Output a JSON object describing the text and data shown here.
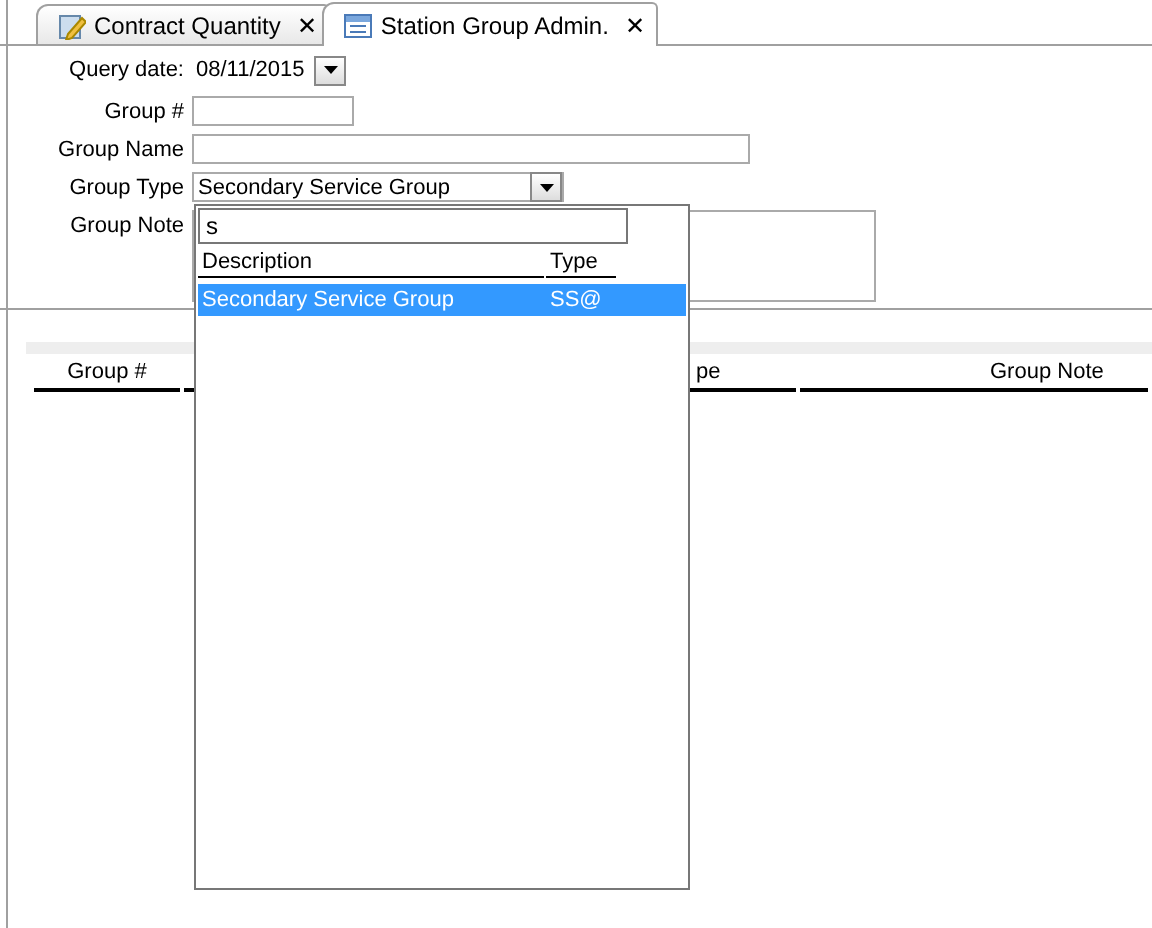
{
  "tabs": [
    {
      "label": "Contract Quantity",
      "selected": false,
      "close": "✕"
    },
    {
      "label": "Station Group Admin.",
      "selected": true,
      "close": "✕"
    }
  ],
  "form": {
    "query_date": {
      "label": "Query date:",
      "value": "08/11/2015"
    },
    "group_number": {
      "label": "Group #"
    },
    "group_name": {
      "label": "Group Name"
    },
    "group_type": {
      "label": "Group Type",
      "value": "Secondary Service Group",
      "expanded": true
    },
    "group_note": {
      "label": "Group Note"
    }
  },
  "dropdown": {
    "search": "s",
    "columns": [
      "Description",
      "Type"
    ],
    "rows": [
      {
        "description": "Secondary Service Group",
        "type": "SS@",
        "selected": true
      }
    ]
  },
  "grid": {
    "columns": [
      "Group #",
      "pe",
      "Group Note"
    ]
  }
}
